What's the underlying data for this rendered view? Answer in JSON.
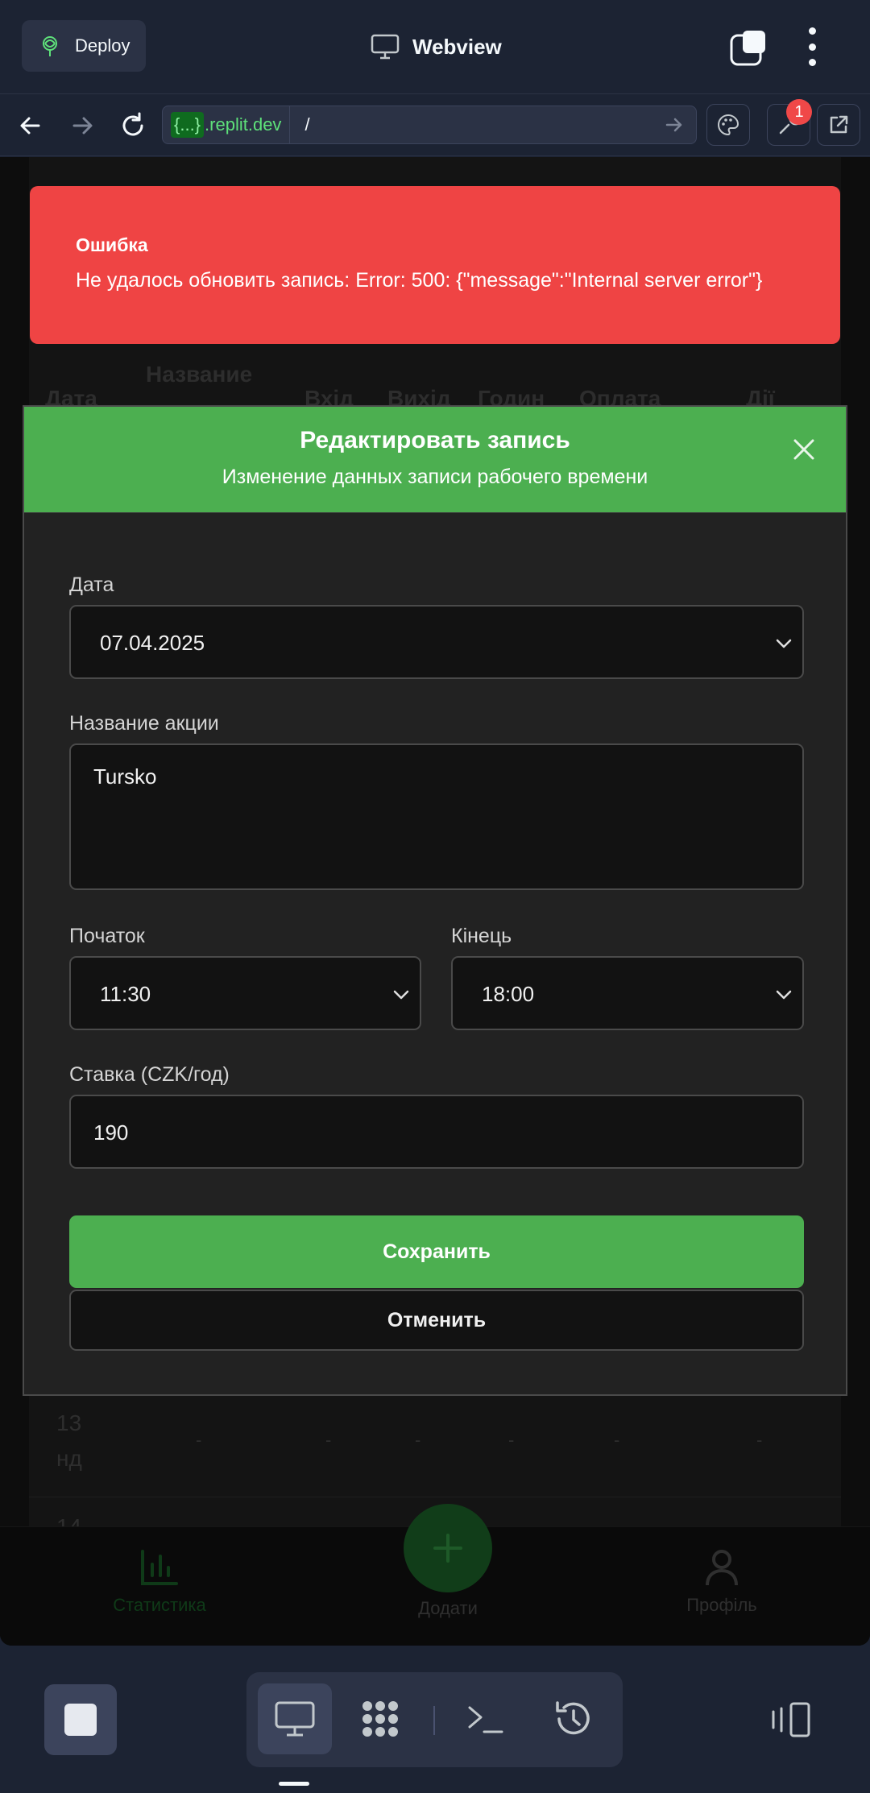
{
  "header": {
    "deploy_label": "Deploy",
    "webview_title": "Webview"
  },
  "address_bar": {
    "url_chip": "{...}",
    "url_domain": ".replit.dev",
    "url_path": "/",
    "notification_count": "1"
  },
  "background_table": {
    "headers": [
      "Дата",
      "Название",
      "Вхід",
      "Вихід",
      "Годин",
      "Оплата",
      "Дії"
    ],
    "row_day": "13",
    "row_weekday": "нд",
    "row_dash": "-",
    "next_row_day": "14"
  },
  "toast": {
    "title": "Ошибка",
    "message": "Не удалось обновить запись: Error: 500: {\"message\":\"Internal server error\"}"
  },
  "modal": {
    "title": "Редактировать запись",
    "subtitle": "Изменение данных записи рабочего времени",
    "date_label": "Дата",
    "date_value": "07.04.2025",
    "action_label": "Название акции",
    "action_value": "Tursko",
    "start_label": "Початок",
    "start_value": "11:30",
    "end_label": "Кінець",
    "end_value": "18:00",
    "rate_label": "Ставка (CZK/год)",
    "rate_value": "190",
    "save_label": "Сохранить",
    "cancel_label": "Отменить"
  },
  "bottom_nav": {
    "stats_label": "Статистика",
    "add_label": "Додати",
    "profile_label": "Профіль"
  },
  "colors": {
    "accent_green": "#4caf50",
    "error_red": "#ef4444",
    "replit_bg": "#1c2333"
  }
}
